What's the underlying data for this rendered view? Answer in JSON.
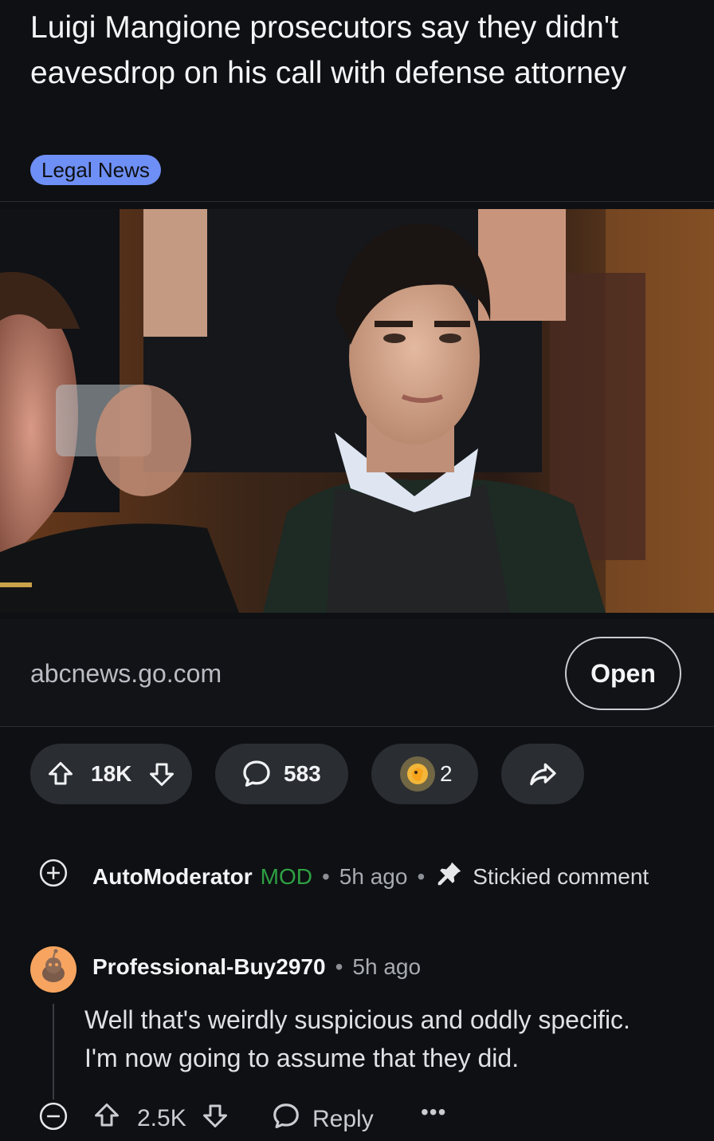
{
  "post": {
    "title": "Luigi Mangione prosecutors say they didn't eavesdrop on his call with defense attorney",
    "flair": "Legal News",
    "link_domain": "abcnews.go.com",
    "open_label": "Open",
    "upvotes": "18K",
    "comments": "583",
    "awards": "2",
    "flair_color": "#6e8ff5"
  },
  "comments": [
    {
      "author": "AutoModerator",
      "mod_label": "MOD",
      "time": "5h ago",
      "pinned_label": "Stickied comment",
      "collapsed": true
    },
    {
      "author": "Professional-Buy2970",
      "time": "5h ago",
      "body_line1": "Well that's weirdly suspicious and oddly specific.",
      "body_line2": "I'm now going to assume that they did.",
      "score": "2.5K",
      "reply_label": "Reply"
    }
  ],
  "colors": {
    "mod": "#2ea043",
    "background": "#0e1013",
    "pill": "#2a2d32"
  }
}
